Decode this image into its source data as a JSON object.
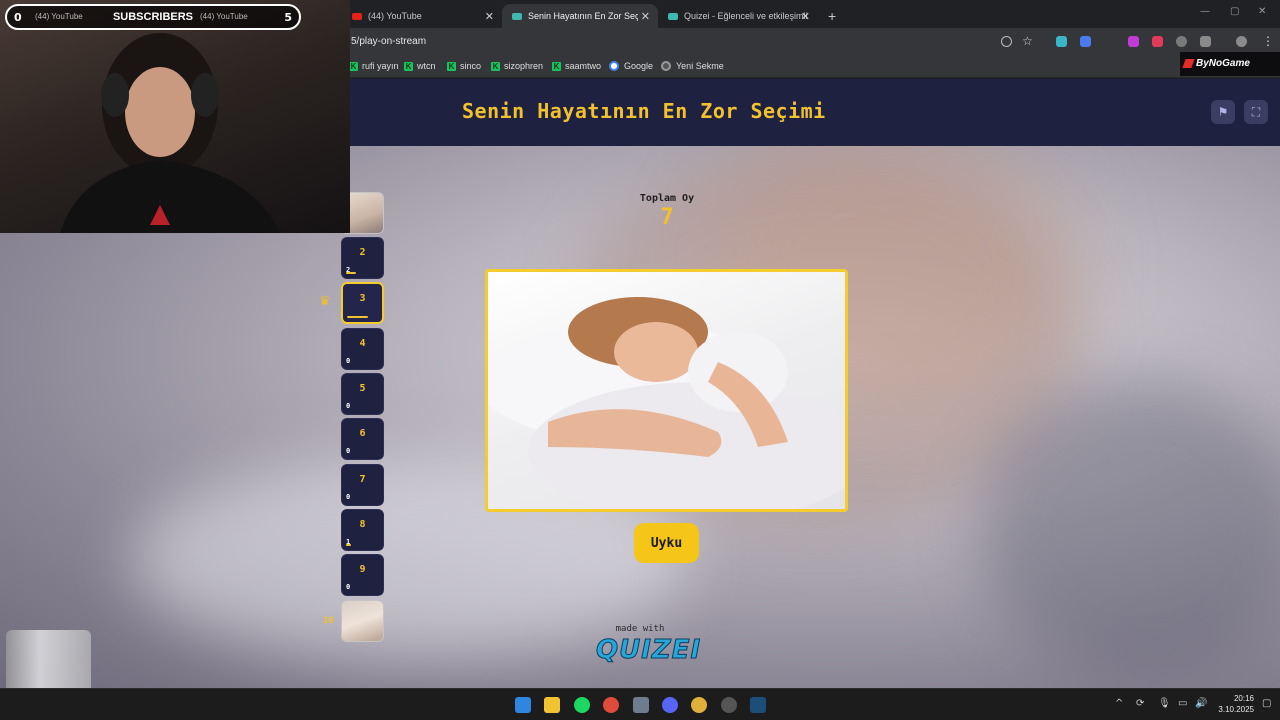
{
  "browser": {
    "tabs": [
      {
        "title": "(44) YouTube"
      },
      {
        "title": "(44) YouTube"
      },
      {
        "title": "(44) YouTube"
      },
      {
        "title": "Senin Hayatının En Zor Seçimi -"
      },
      {
        "title": "Quizei - Eğlenceli ve etkileşimli"
      }
    ],
    "new_tab": "+",
    "url": "5/play-on-stream",
    "bookmarks": [
      "rufi yayın",
      "wtcn",
      "sinco",
      "sizophren",
      "saamtwo",
      "Google",
      "Yeni Sekme"
    ]
  },
  "overlay": {
    "subscribers_left": "0",
    "subscribers_label": "SUBSCRIBERS",
    "subscribers_right": "5",
    "sponsor": "ByNoGame"
  },
  "page": {
    "title": "Senin Hayatının En Zor Seçimi",
    "total_votes_label": "Toplam Oy",
    "total_votes": "7",
    "answer_label": "Uyku",
    "made_with": "made with",
    "brand": "QUIZEI",
    "header_icons": [
      "flag-icon",
      "fullscreen-icon"
    ]
  },
  "rounds": [
    {
      "num": "2",
      "count": "2",
      "fill": 0.28
    },
    {
      "num": "3",
      "count": "",
      "fill": 0.6,
      "selected": true
    },
    {
      "num": "4",
      "count": "0",
      "fill": 0
    },
    {
      "num": "5",
      "count": "0",
      "fill": 0
    },
    {
      "num": "6",
      "count": "0",
      "fill": 0
    },
    {
      "num": "7",
      "count": "0",
      "fill": 0
    },
    {
      "num": "8",
      "count": "1",
      "fill": 0.14
    },
    {
      "num": "9",
      "count": "0",
      "fill": 0
    }
  ],
  "last_round": "10",
  "taskbar": {
    "time": "20:16",
    "date": "3.10.2025"
  },
  "colors": {
    "accent": "#f2c12e",
    "header_bg": "#1f2140",
    "button": "#f5c518"
  }
}
